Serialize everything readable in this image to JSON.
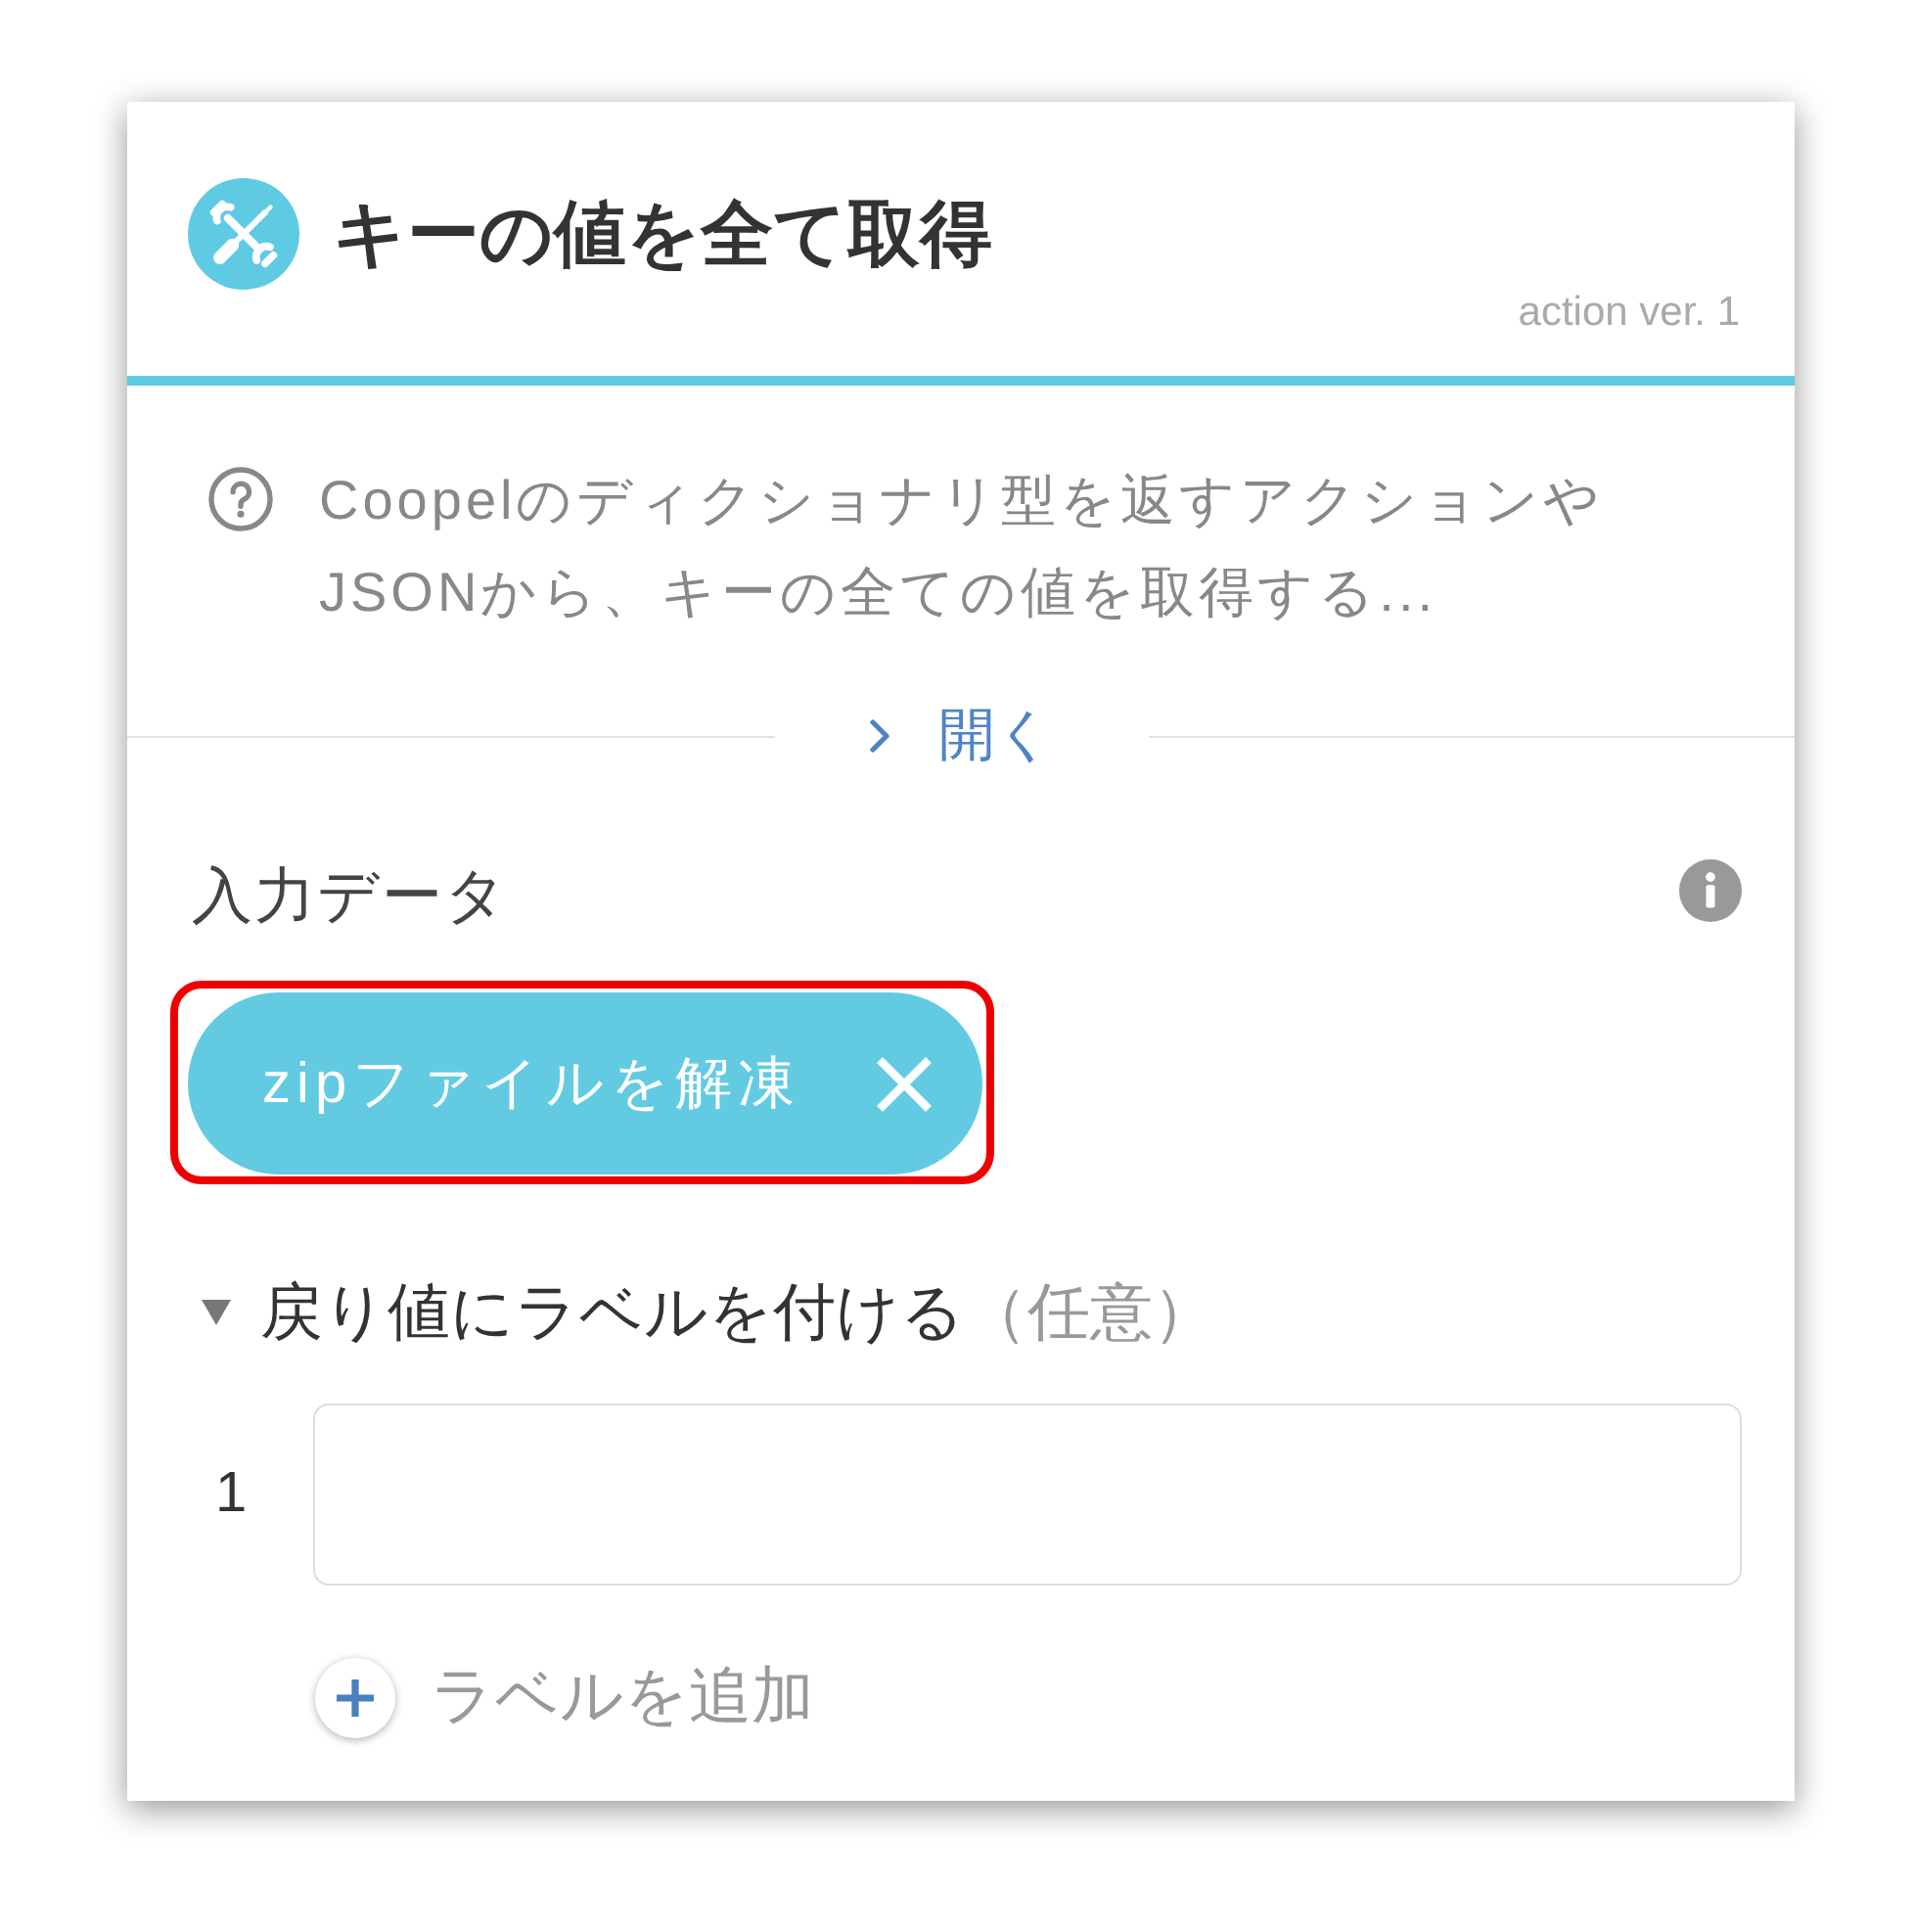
{
  "header": {
    "title": "キーの値を全て取得",
    "version": "action ver. 1"
  },
  "description": {
    "text": "Coopelのディクショナリ型を返すアクションやJSONから、キーの全ての値を取得する...",
    "toggle": {
      "label": "開く",
      "expanded": false
    }
  },
  "input_data": {
    "label": "入力データ",
    "chips": [
      {
        "label": "zipファイルを解凍",
        "highlighted": true
      }
    ]
  },
  "return_labels": {
    "title": "戻り値にラベルを付ける",
    "note": "（任意）",
    "expanded": true,
    "rows": [
      {
        "index": "1"
      }
    ],
    "add_button": "ラベルを追加"
  }
}
